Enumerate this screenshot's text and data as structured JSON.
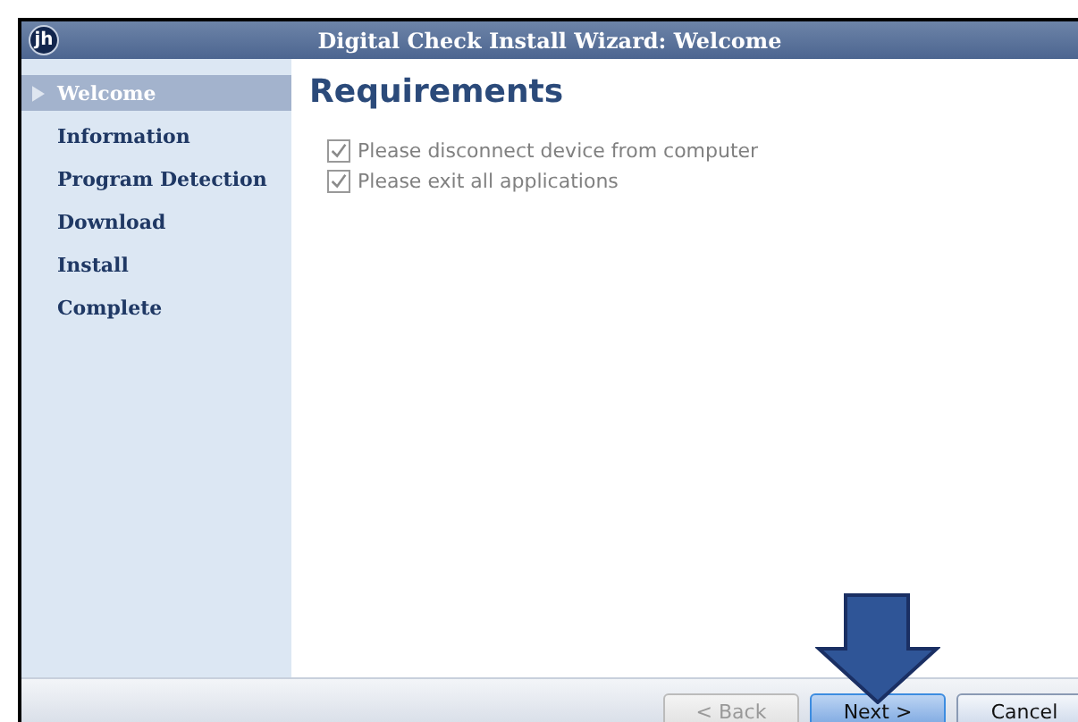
{
  "window": {
    "title": "Digital Check Install Wizard: Welcome",
    "logo": "jh"
  },
  "steps": [
    {
      "label": "Welcome",
      "selected": true
    },
    {
      "label": "Information",
      "selected": false
    },
    {
      "label": "Program Detection",
      "selected": false
    },
    {
      "label": "Download",
      "selected": false
    },
    {
      "label": "Install",
      "selected": false
    },
    {
      "label": "Complete",
      "selected": false
    }
  ],
  "heading": "Requirements",
  "requirements": [
    {
      "label": "Please disconnect device from computer",
      "checked": true,
      "disabled": true
    },
    {
      "label": "Please exit all applications",
      "checked": true,
      "disabled": true
    }
  ],
  "buttons": [
    {
      "label": "< Back",
      "disabled": true,
      "selected": false
    },
    {
      "label": "Next >",
      "disabled": false,
      "selected": true
    },
    {
      "label": "Cancel",
      "disabled": false,
      "selected": false
    }
  ]
}
